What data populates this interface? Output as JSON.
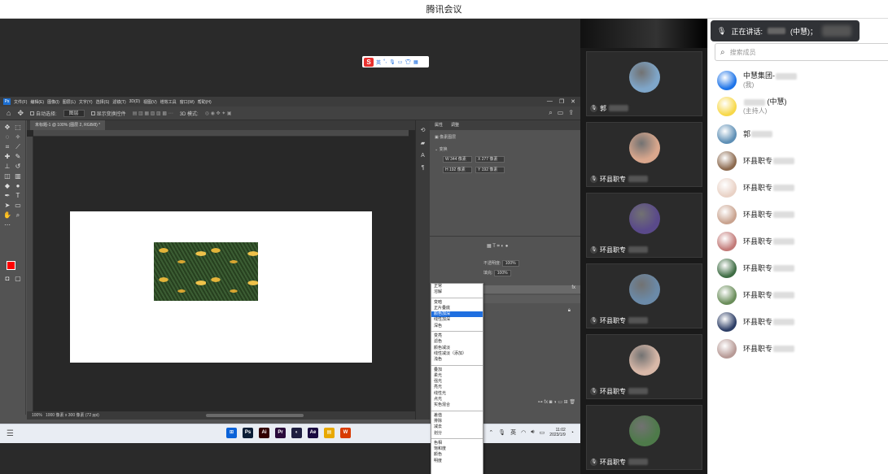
{
  "window": {
    "title": "腾讯会议"
  },
  "photoshop": {
    "menu": [
      "文件(F)",
      "编辑(E)",
      "图像(I)",
      "图层(L)",
      "文字(Y)",
      "选择(S)",
      "滤镜(T)",
      "3D(D)",
      "视图(V)",
      "增效工具",
      "窗口(W)",
      "帮助(H)"
    ],
    "options": {
      "auto_select": "自动选择:",
      "target": "图层",
      "show_transform": "显示变换控件",
      "mode3d": "3D 模式:"
    },
    "doc_tab": "未标题-1 @ 100% (图层 2, RGB/8) *",
    "status": {
      "zoom": "100%",
      "size": "1000 像素 x 300 像素 (72 ppi)"
    },
    "props_tabs": [
      "属性",
      "调整"
    ],
    "props": {
      "section": "像素图层",
      "transform": "变换",
      "w": "W  344 像素",
      "x": "X  277 像素",
      "h": "H  192 像素",
      "y": "Y  192 像素"
    },
    "layers": {
      "opacity_label": "不透明度:",
      "opacity": "100%",
      "fill_label": "填充:",
      "fill": "100%",
      "fx": "fx"
    },
    "blend_menu": {
      "groups": [
        [
          "正常",
          "溶解"
        ],
        [
          "变暗",
          "正片叠底",
          "颜色加深",
          "线性加深",
          "深色"
        ],
        [
          "变亮",
          "滤色",
          "颜色减淡",
          "线性减淡（添加）",
          "浅色"
        ],
        [
          "叠加",
          "柔光",
          "强光",
          "亮光",
          "线性光",
          "点光",
          "实色混合"
        ],
        [
          "差值",
          "排除",
          "减去",
          "划分"
        ],
        [
          "色相",
          "饱和度",
          "颜色",
          "明度"
        ]
      ],
      "selected": "颜色加深"
    },
    "sogou": {
      "logo": "S",
      "mode": "英"
    }
  },
  "taskbar": {
    "apps": [
      {
        "label": "⊞",
        "color": "#0a62d8"
      },
      {
        "label": "Ps",
        "color": "#0d1e36"
      },
      {
        "label": "Ai",
        "color": "#330000"
      },
      {
        "label": "Pr",
        "color": "#2a0a3a"
      },
      {
        "label": "◐",
        "color": "#1e1e40"
      },
      {
        "label": "Ae",
        "color": "#1a0a40"
      },
      {
        "label": "▤",
        "color": "#e8a800"
      },
      {
        "label": "W",
        "color": "#d83b01"
      }
    ],
    "time": "11:02",
    "date": "2023/1/9"
  },
  "videos": [
    {
      "name": "郭",
      "color": "#7fa6c9"
    },
    {
      "name": "环县职专",
      "color": "#d9a78d"
    },
    {
      "name": "环县职专",
      "color": "#5a4a8a"
    },
    {
      "name": "环县职专",
      "color": "#6b8aa8"
    },
    {
      "name": "环县职专",
      "color": "#d8b8a8"
    },
    {
      "name": "环县职专",
      "color": "#4e7a4a"
    }
  ],
  "members_panel": {
    "speaking_label": "正在讲话:",
    "speaking_name": "(中慧)；",
    "search_placeholder": "搜索成员",
    "members": [
      {
        "name": "中慧集团-",
        "sub": "(我)",
        "color": "#1e74e8"
      },
      {
        "name": "(中慧)",
        "sub": "(主持人)",
        "color": "#f7d84a"
      },
      {
        "name": "郭",
        "sub": "",
        "color": "#5e8fb5"
      },
      {
        "name": "环县职专",
        "sub": "",
        "color": "#8c6a4f"
      },
      {
        "name": "环县职专",
        "sub": "",
        "color": "#e9d2c6"
      },
      {
        "name": "环县职专",
        "sub": "",
        "color": "#c9a38f"
      },
      {
        "name": "环县职专",
        "sub": "",
        "color": "#c27a78"
      },
      {
        "name": "环县职专",
        "sub": "",
        "color": "#3f6d44"
      },
      {
        "name": "环县职专",
        "sub": "",
        "color": "#6a8d5a"
      },
      {
        "name": "环县职专",
        "sub": "",
        "color": "#2d3e66"
      },
      {
        "name": "环县职专",
        "sub": "",
        "color": "#b79a96"
      }
    ]
  }
}
